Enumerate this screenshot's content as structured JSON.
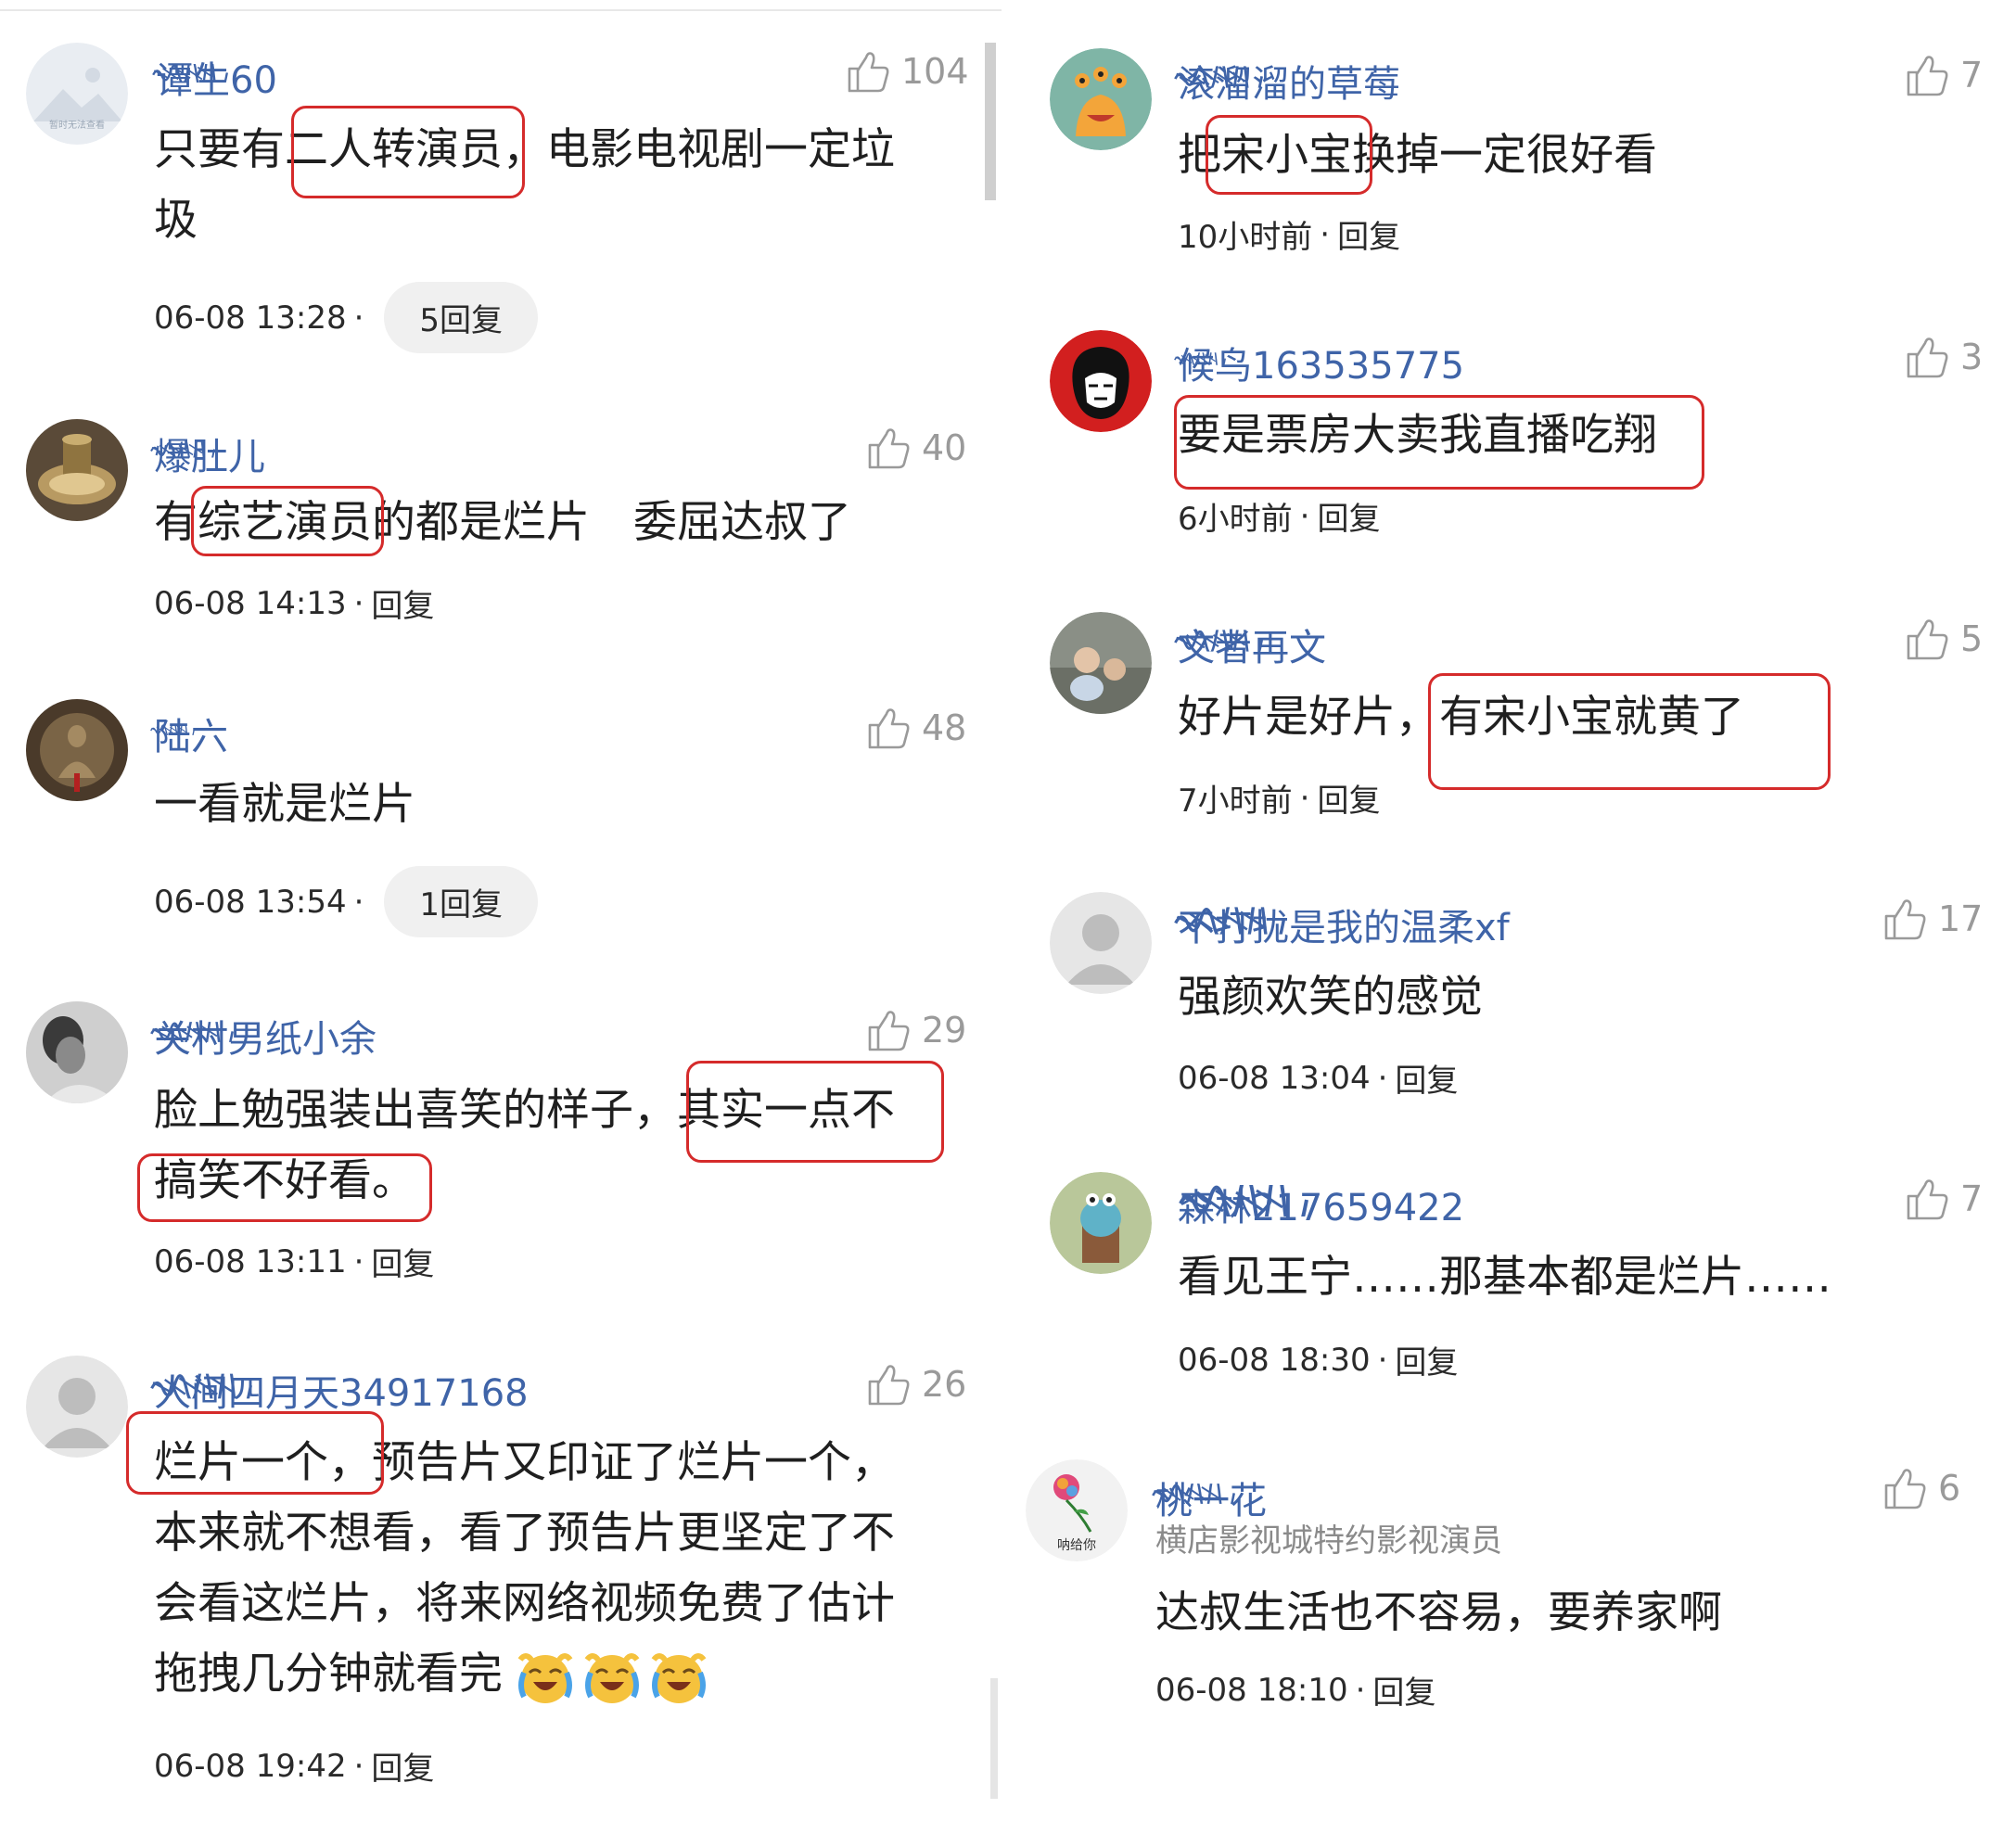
{
  "left": [
    {
      "user": "谭生60",
      "likes": "104",
      "lines": [
        "只要有二人转演员，电影电视剧一定垃",
        "圾"
      ],
      "time": "06-08 13:28",
      "dot": "·",
      "replies": "5回复"
    },
    {
      "user": "爆肚儿",
      "likes": "40",
      "lines": [
        "有综艺演员的都是烂片　委屈达叔了"
      ],
      "time": "06-08 14:13",
      "dot": "·",
      "reply": "回复"
    },
    {
      "user": "陆六",
      "likes": "48",
      "lines": [
        "一看就是烂片"
      ],
      "time": "06-08 13:54",
      "dot": "·",
      "replies": "1回复"
    },
    {
      "user": "关村男纸小余",
      "likes": "29",
      "lines": [
        "脸上勉强装出喜笑的样子，其实一点不",
        "搞笑不好看。"
      ],
      "time": "06-08 13:11",
      "dot": "·",
      "reply": "回复"
    },
    {
      "user": "人间四月天34917168",
      "likes": "26",
      "lines": [
        "烂片一个，预告片又印证了烂片一个，",
        "本来就不想看，看了预告片更坚定了不",
        "会看这烂片，将来网络视频免费了估计",
        "拖拽几分钟就看完"
      ],
      "time": "06-08 19:42",
      "dot": "·",
      "reply": "回复"
    }
  ],
  "right": [
    {
      "user": "滚溜溜的草莓",
      "likes": "7",
      "lines": [
        "把宋小宝换掉一定很好看"
      ],
      "time": "10小时前",
      "dot": "·",
      "reply": "回复"
    },
    {
      "user": "候鸟163535775",
      "likes": "3",
      "lines": [
        "要是票房大卖我直播吃翔"
      ],
      "time": "6小时前",
      "dot": "·",
      "reply": "回复"
    },
    {
      "user": "文者再文",
      "likes": "5",
      "lines": [
        "好片是好片，有宋小宝就黄了"
      ],
      "time": "7小时前",
      "dot": "·",
      "reply": "回复"
    },
    {
      "user": "不打扰是我的温柔xf",
      "likes": "17",
      "lines": [
        "强颜欢笑的感觉"
      ],
      "time": "06-08 13:04",
      "dot": "·",
      "reply": "回复"
    },
    {
      "user": "森林217659422",
      "likes": "7",
      "lines": [
        "看见王宁……那基本都是烂片……"
      ],
      "time": "06-08 18:30",
      "dot": "·",
      "reply": "回复"
    },
    {
      "user": "桃一花",
      "subtitle": "横店影视城特约影视演员",
      "likes": "6",
      "lines": [
        "达叔生活也不容易，要养家啊"
      ],
      "time": "06-08 18:10",
      "dot": "·",
      "reply": "回复"
    }
  ],
  "avatar_texts": {
    "placeholder": "暂时无法查看",
    "rose": "呐给你"
  },
  "colors": {
    "username": "#3f64a8",
    "highlight": "#d52b2b",
    "meta": "#2a2a2a",
    "like": "#9a9a9a"
  },
  "icons": [
    "thumbs-up-icon",
    "laughing-crying-emoji-icon"
  ]
}
